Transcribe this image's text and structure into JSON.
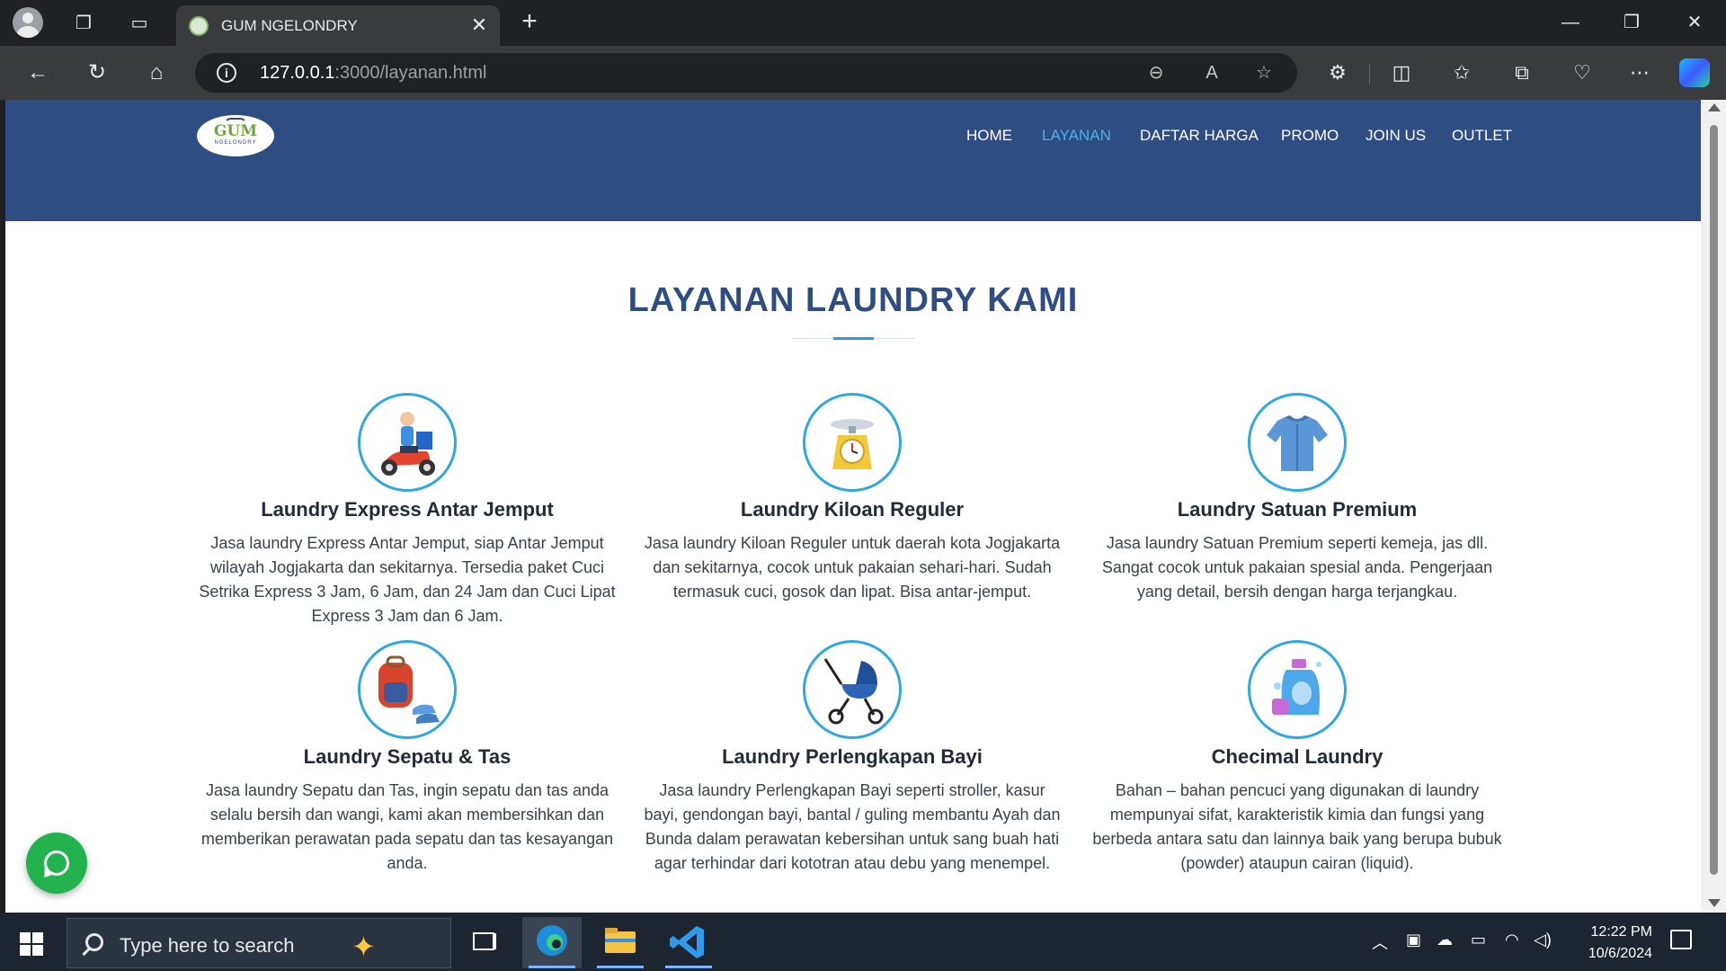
{
  "browser": {
    "tab_title": "GUM NGELONDRY",
    "url_host": "127.0.0.1",
    "url_rest": ":3000/layanan.html"
  },
  "site": {
    "logo_text": "GUM",
    "logo_sub": "NGELONDRY",
    "nav": [
      {
        "label": "HOME",
        "active": false
      },
      {
        "label": "LAYANAN",
        "active": true
      },
      {
        "label": "DAFTAR HARGA",
        "active": false
      },
      {
        "label": "PROMO",
        "active": false
      },
      {
        "label": "JOIN US",
        "active": false
      },
      {
        "label": "OUTLET",
        "active": false
      }
    ],
    "section_title": "LAYANAN LAUNDRY KAMI",
    "services": [
      {
        "title": "Laundry Express Antar Jemput",
        "desc": "Jasa laundry Express Antar Jemput, siap Antar Jemput wilayah Jogjakarta dan sekitarnya. Tersedia paket Cuci Setrika Express 3 Jam, 6 Jam, dan 24 Jam dan Cuci Lipat Express 3 Jam dan 6 Jam.",
        "icon": "scooter-delivery-icon"
      },
      {
        "title": "Laundry Kiloan Reguler",
        "desc": "Jasa laundry Kiloan Reguler untuk daerah kota Jogjakarta dan sekitarnya, cocok untuk pakaian sehari-hari. Sudah termasuk cuci, gosok dan lipat. Bisa antar-jemput.",
        "icon": "weighing-scale-icon"
      },
      {
        "title": "Laundry Satuan Premium",
        "desc": "Jasa laundry Satuan Premium seperti kemeja, jas dll. Sangat cocok untuk pakaian spesial anda. Pengerjaan yang detail, bersih dengan harga terjangkau.",
        "icon": "shirt-icon"
      },
      {
        "title": "Laundry Sepatu & Tas",
        "desc": "Jasa laundry Sepatu dan Tas, ingin sepatu dan tas anda selalu bersih dan wangi, kami akan membersihkan dan memberikan perawatan pada sepatu dan tas kesayangan anda.",
        "icon": "backpack-shoes-icon"
      },
      {
        "title": "Laundry Perlengkapan Bayi",
        "desc": "Jasa laundry Perlengkapan Bayi seperti stroller, kasur bayi, gendongan bayi, bantal / guling membantu Ayah dan Bunda dalam perawatan kebersihan untuk sang buah hati agar terhindar dari kototran atau debu yang menempel.",
        "icon": "baby-stroller-icon"
      },
      {
        "title": "Checimal Laundry",
        "desc": "Bahan – bahan pencuci yang digunakan di laundry mempunyai sifat, karakteristik kimia dan fungsi yang berbeda antara satu dan lainnya baik yang berupa bubuk (powder) ataupun cairan (liquid).",
        "icon": "detergent-bottle-icon"
      }
    ]
  },
  "taskbar": {
    "search_placeholder": "Type here to search",
    "time": "12:22 PM",
    "date": "10/6/2024"
  },
  "colors": {
    "header_bg": "#2e4d82",
    "nav_active": "#4fb1e8",
    "accent": "#2f9bd6",
    "whatsapp": "#22b34f"
  }
}
